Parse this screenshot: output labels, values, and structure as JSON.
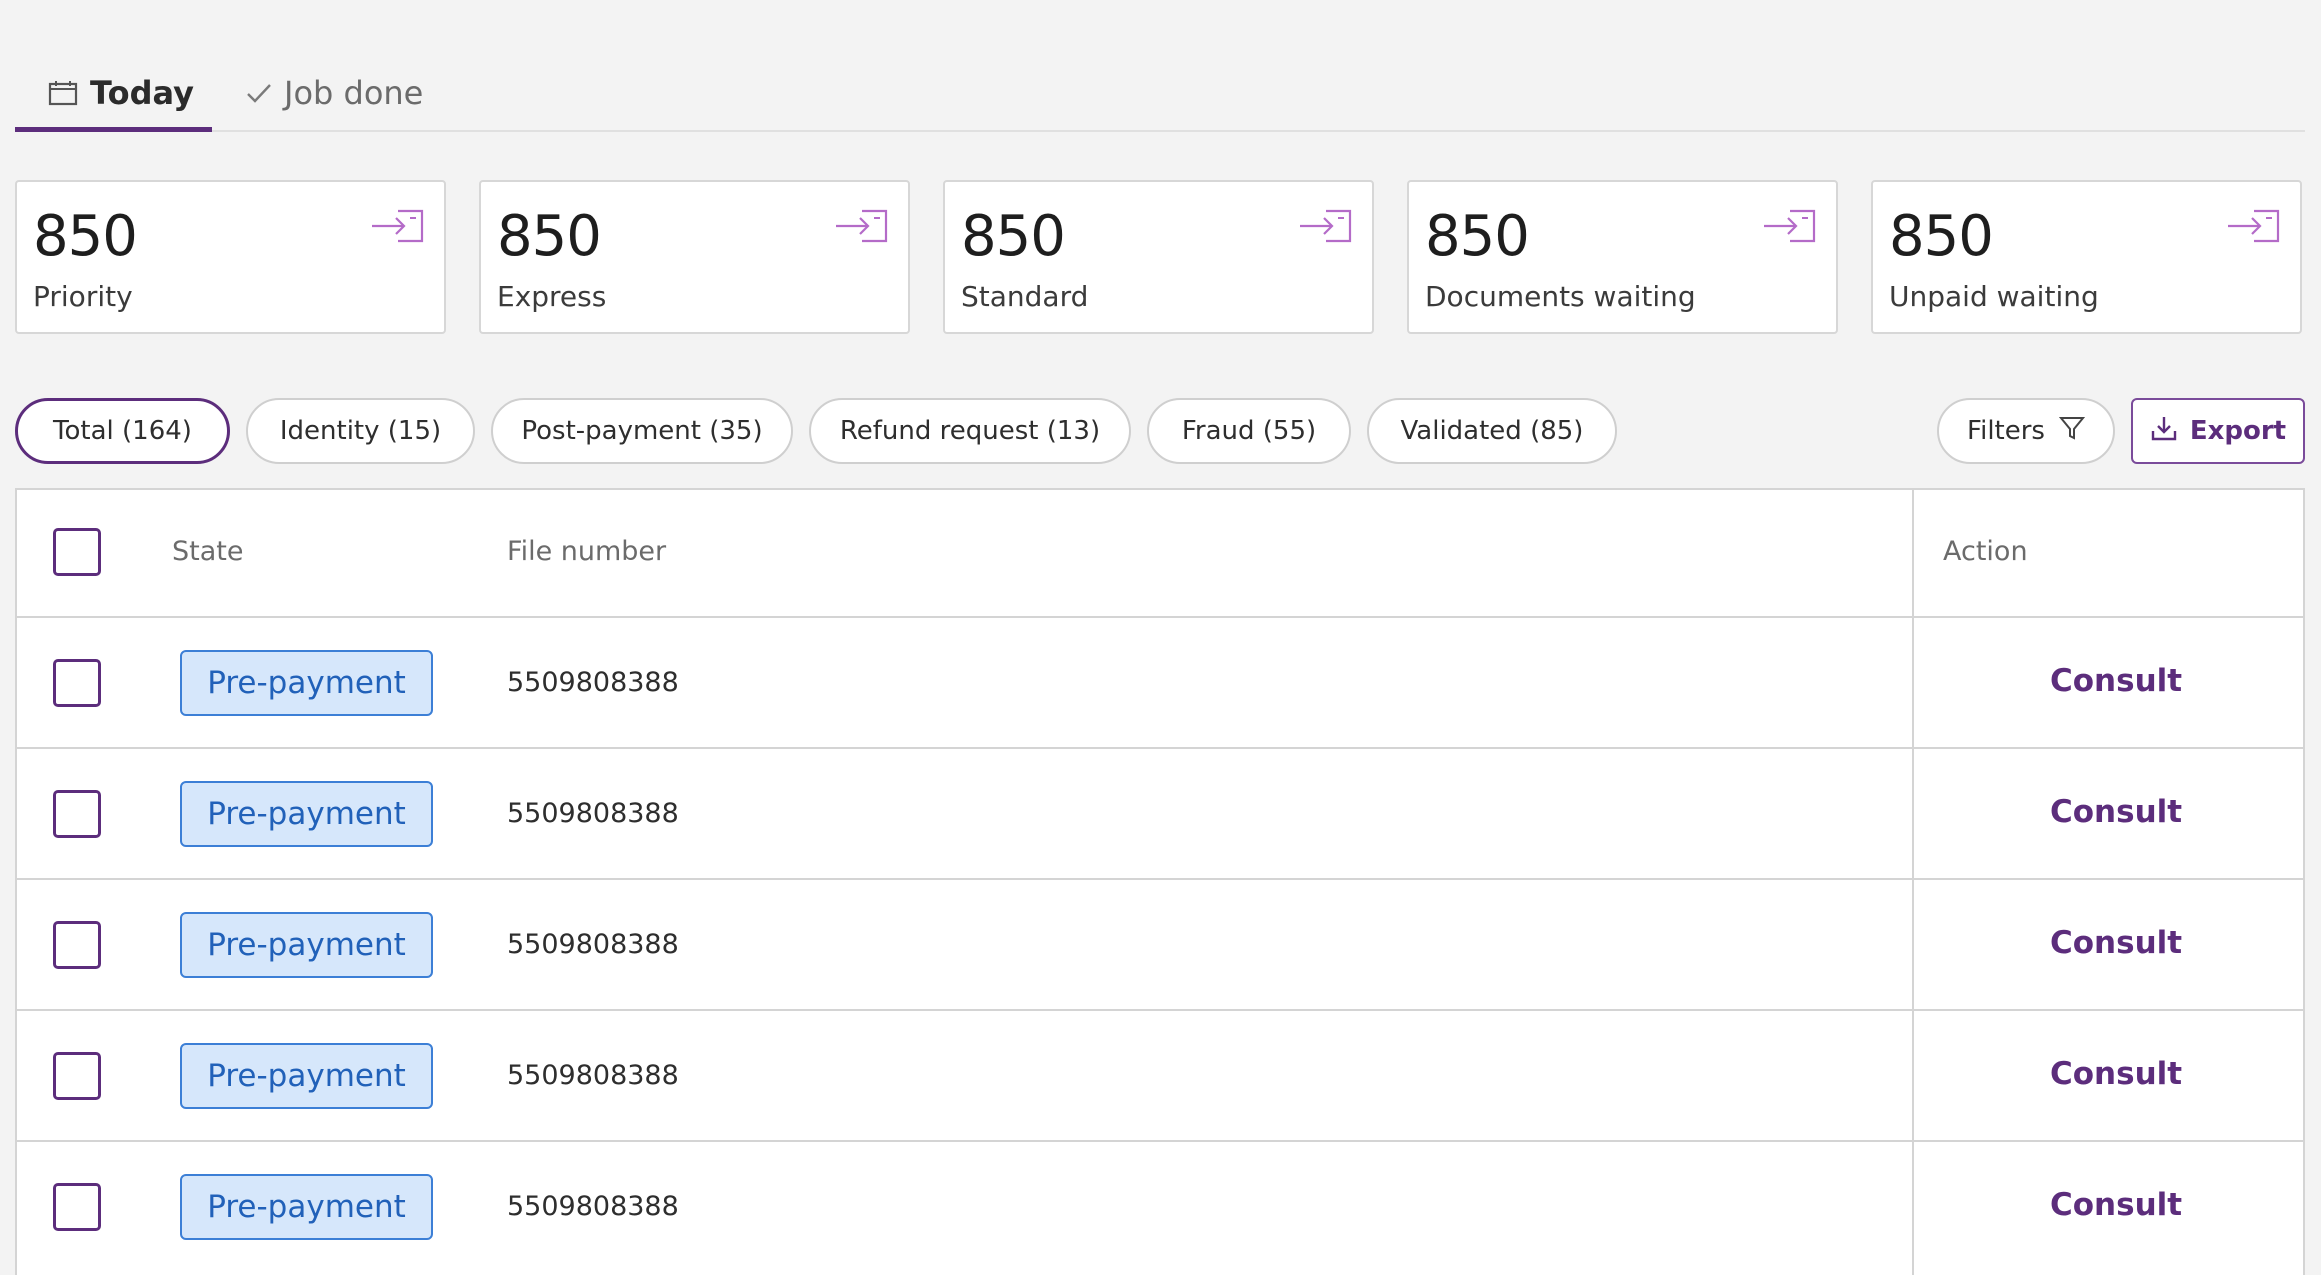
{
  "tabs": [
    {
      "label": "Today",
      "icon": "calendar-icon",
      "active": true
    },
    {
      "label": "Job done",
      "icon": "check-icon",
      "active": false
    }
  ],
  "cards": [
    {
      "value": "850",
      "label": "Priority"
    },
    {
      "value": "850",
      "label": "Express"
    },
    {
      "value": "850",
      "label": "Standard"
    },
    {
      "value": "850",
      "label": "Documents waiting"
    },
    {
      "value": "850",
      "label": "Unpaid waiting"
    }
  ],
  "chips": [
    {
      "label": "Total (164)",
      "active": true
    },
    {
      "label": "Identity (15)",
      "active": false
    },
    {
      "label": "Post-payment (35)",
      "active": false
    },
    {
      "label": "Refund request (13)",
      "active": false
    },
    {
      "label": "Fraud (55)",
      "active": false
    },
    {
      "label": "Validated (85)",
      "active": false
    }
  ],
  "toolbar": {
    "filters_label": "Filters",
    "export_label": "Export"
  },
  "table": {
    "headers": {
      "state": "State",
      "file_number": "File number",
      "action": "Action"
    },
    "rows": [
      {
        "state": "Pre-payment",
        "file_number": "5509808388",
        "action": "Consult"
      },
      {
        "state": "Pre-payment",
        "file_number": "5509808388",
        "action": "Consult"
      },
      {
        "state": "Pre-payment",
        "file_number": "5509808388",
        "action": "Consult"
      },
      {
        "state": "Pre-payment",
        "file_number": "5509808388",
        "action": "Consult"
      },
      {
        "state": "Pre-payment",
        "file_number": "5509808388",
        "action": "Consult"
      }
    ]
  },
  "colors": {
    "accent": "#5c2d7c",
    "badge_bg": "#d6e7fb",
    "badge_text": "#2161b9"
  }
}
